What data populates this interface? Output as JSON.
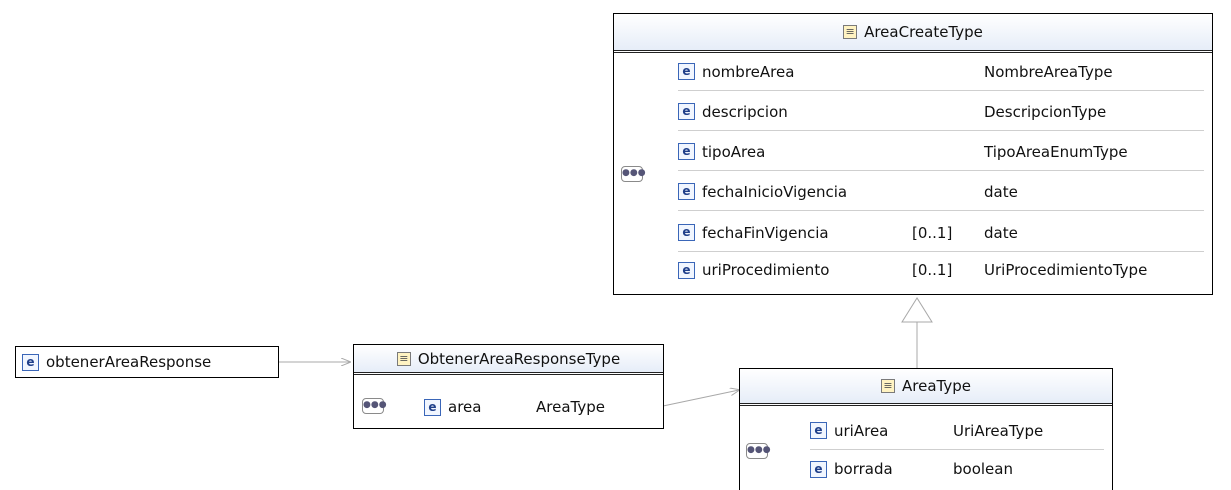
{
  "element_icon": "e",
  "complex_type_icon": "complex-type-icon",
  "sequence_icon": "sequence-icon",
  "root_element": {
    "name": "obtenerAreaResponse"
  },
  "obtener_type": {
    "title": "ObtenerAreaResponseType",
    "elements": [
      {
        "name": "area",
        "cardinality": "",
        "type": "AreaType"
      }
    ]
  },
  "area_create_type": {
    "title": "AreaCreateType",
    "elements": [
      {
        "name": "nombreArea",
        "cardinality": "",
        "type": "NombreAreaType"
      },
      {
        "name": "descripcion",
        "cardinality": "",
        "type": "DescripcionType"
      },
      {
        "name": "tipoArea",
        "cardinality": "",
        "type": "TipoAreaEnumType"
      },
      {
        "name": "fechaInicioVigencia",
        "cardinality": "",
        "type": "date"
      },
      {
        "name": "fechaFinVigencia",
        "cardinality": "[0..1]",
        "type": "date"
      },
      {
        "name": "uriProcedimiento",
        "cardinality": "[0..1]",
        "type": "UriProcedimientoType"
      }
    ]
  },
  "area_type": {
    "title": "AreaType",
    "elements": [
      {
        "name": "uriArea",
        "cardinality": "",
        "type": "UriAreaType"
      },
      {
        "name": "borrada",
        "cardinality": "",
        "type": "boolean"
      }
    ]
  },
  "colors": {
    "element_border": "#3a66b8",
    "header_gradient_end": "#e6edf8",
    "connector": "#a8a8a8"
  }
}
